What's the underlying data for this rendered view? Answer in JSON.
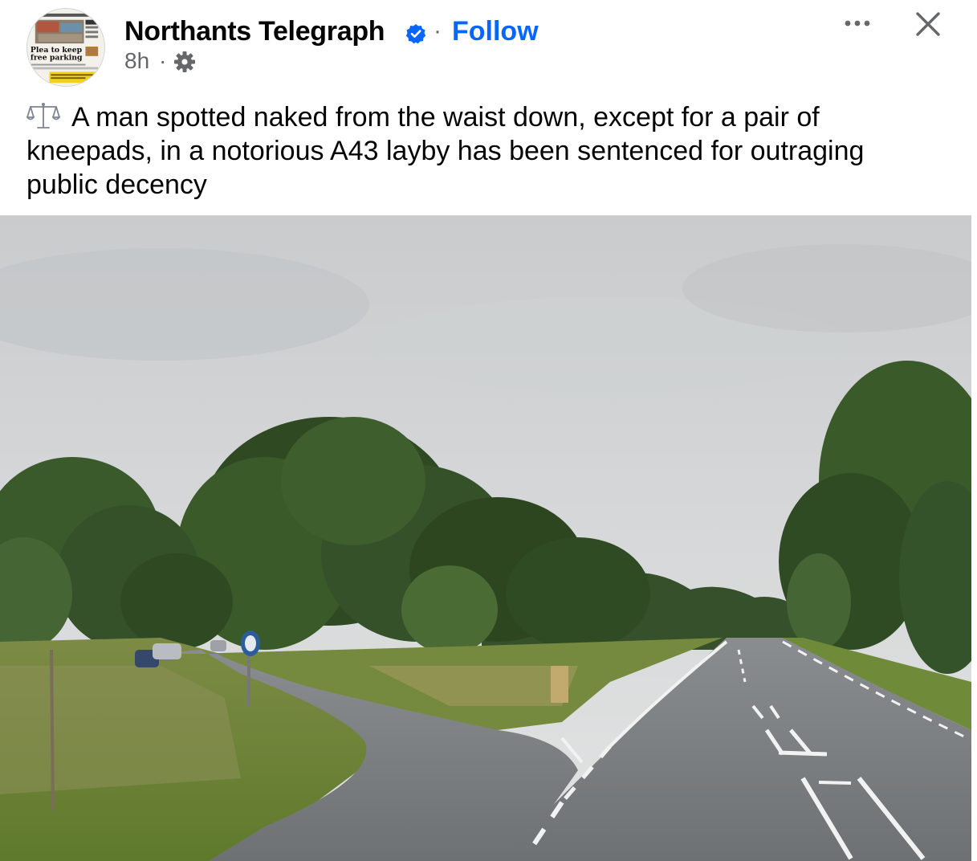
{
  "post": {
    "page_name": "Northants Telegraph",
    "follow_label": "Follow",
    "separator": "·",
    "timestamp": "8h",
    "meta_separator": "·",
    "verified_icon": "verified-badge-icon",
    "privacy_icon": "gear-icon",
    "more_icon": "more-options-icon",
    "close_icon": "close-icon",
    "text_icon": "balance-scale-icon",
    "text_lines": [
      "A man spotted naked from the waist down, except for a pair of",
      "kneepads, in a notorious A43 layby has been sentenced for outraging",
      "public decency"
    ],
    "avatar": {
      "headline": "Plea to keep free parking"
    }
  },
  "colors": {
    "link": "#0866ff",
    "text": "#050505",
    "secondary": "#65676b",
    "divider": "#ced0d4"
  }
}
